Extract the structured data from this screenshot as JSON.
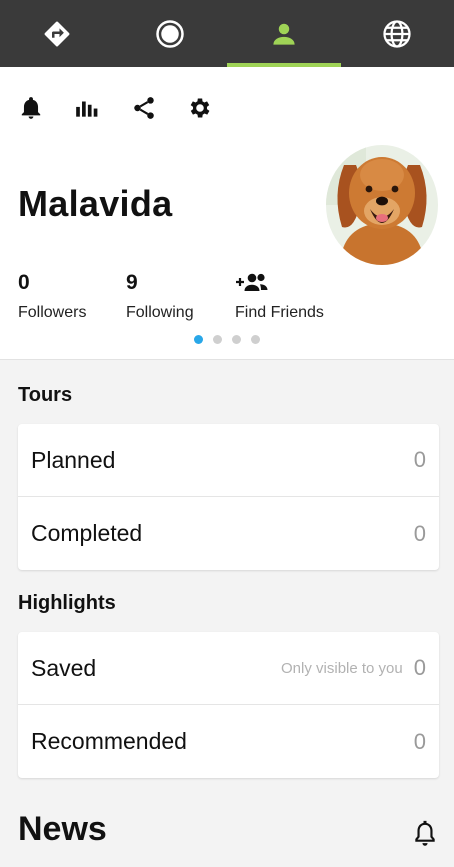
{
  "nav": {
    "colors": {
      "bar": "#3a3a3a",
      "icon": "#ffffff",
      "active": "#9fd356"
    },
    "tabs": [
      {
        "icon": "directions-icon",
        "active": false
      },
      {
        "icon": "record-icon",
        "active": false
      },
      {
        "icon": "profile-icon",
        "active": true
      },
      {
        "icon": "globe-icon",
        "active": false
      }
    ]
  },
  "toolbar": {
    "icons": [
      "bell-icon",
      "stats-icon",
      "share-icon",
      "settings-icon"
    ]
  },
  "profile": {
    "username": "Malavida",
    "stats": [
      {
        "value": "0",
        "label": "Followers"
      },
      {
        "value": "9",
        "label": "Following"
      },
      {
        "icon": "add-friends-icon",
        "label": "Find Friends"
      }
    ],
    "pager": {
      "count": 4,
      "active_index": 0,
      "active_color": "#29a7e8"
    }
  },
  "tours": {
    "title": "Tours",
    "rows": [
      {
        "label": "Planned",
        "count": "0"
      },
      {
        "label": "Completed",
        "count": "0"
      }
    ]
  },
  "highlights": {
    "title": "Highlights",
    "rows": [
      {
        "label": "Saved",
        "hint": "Only visible to you",
        "count": "0"
      },
      {
        "label": "Recommended",
        "count": "0"
      }
    ]
  },
  "news": {
    "title": "News",
    "icon": "bell-outline-icon"
  }
}
